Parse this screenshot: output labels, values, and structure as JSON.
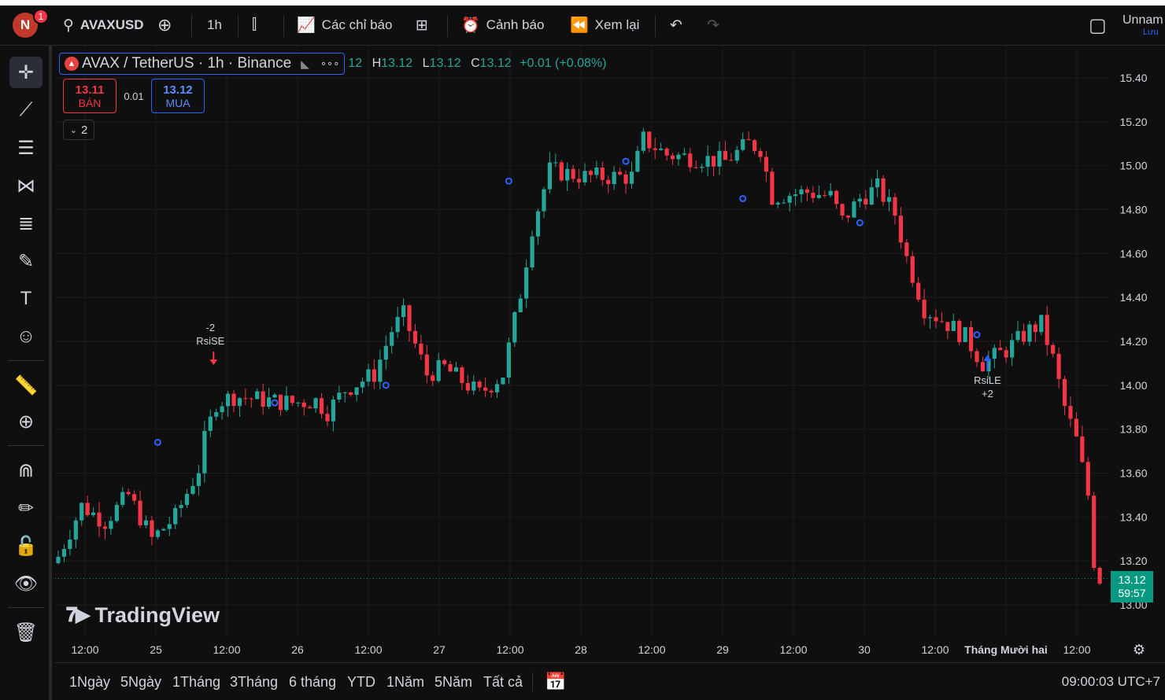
{
  "user": {
    "initial": "N",
    "notifications": "1"
  },
  "toolbar": {
    "symbol": "AVAXUSD",
    "interval": "1h",
    "indicators": "Các chỉ báo",
    "alerts": "Cảnh báo",
    "replay": "Xem lại",
    "layout_name": "Unnam",
    "layout_sub": "Lưu"
  },
  "legend": {
    "title": "AVAX / TetherUS · 1h · Binance",
    "open_fragment": "12",
    "h_label": "H",
    "h": "13.12",
    "l_label": "L",
    "l": "13.12",
    "c_label": "C",
    "c": "13.12",
    "change": "+0.01 (+0.08%)",
    "more": "∘∘∘"
  },
  "trade": {
    "sell_price": "13.11",
    "sell_label": "BÁN",
    "spread": "0.01",
    "buy_price": "13.12",
    "buy_label": "MUA",
    "collapse_count": "2"
  },
  "watermark": "TradingView",
  "price_badge": {
    "price": "13.12",
    "countdown": "59:57"
  },
  "ranges": [
    "1Ngày",
    "5Ngày",
    "1Tháng",
    "3Tháng",
    "6 tháng",
    "YTD",
    "1Năm",
    "5Năm",
    "Tất cả"
  ],
  "clock": "09:00:03 UTC+7",
  "colors": {
    "up": "#26a69a",
    "down": "#f23645",
    "marker": "#2962ff",
    "badge": "#089981"
  },
  "chart_data": {
    "type": "candlestick",
    "ylim": [
      12.88,
      15.52
    ],
    "y_ticks": [
      "15.40",
      "15.20",
      "15.00",
      "14.80",
      "14.60",
      "14.40",
      "14.20",
      "14.00",
      "13.80",
      "13.60",
      "13.40",
      "13.20",
      "13.00"
    ],
    "x_ticks": [
      "12:00",
      "25",
      "12:00",
      "26",
      "12:00",
      "27",
      "12:00",
      "28",
      "12:00",
      "29",
      "12:00",
      "30",
      "12:00",
      "Tháng Mười hai",
      "12:00"
    ],
    "last_price": 13.12,
    "annotations": [
      {
        "label": "RsiSE",
        "value": "-2",
        "direction": "down",
        "price": 14.06
      },
      {
        "label": "RsiLE",
        "value": "+2",
        "direction": "up",
        "price": 14.16
      }
    ],
    "close_path": [
      [
        0,
        13.22
      ],
      [
        4,
        13.45
      ],
      [
        8,
        13.38
      ],
      [
        12,
        13.5
      ],
      [
        16,
        13.3
      ],
      [
        20,
        13.4
      ],
      [
        24,
        13.62
      ],
      [
        25,
        13.75
      ],
      [
        27,
        13.92
      ],
      [
        30,
        13.95
      ],
      [
        36,
        13.93
      ],
      [
        40,
        13.92
      ],
      [
        44,
        13.93
      ],
      [
        46,
        13.88
      ],
      [
        49,
        13.98
      ],
      [
        54,
        14.05
      ],
      [
        57,
        14.25
      ],
      [
        59,
        14.32
      ],
      [
        63,
        14.05
      ],
      [
        66,
        14.08
      ],
      [
        70,
        14.0
      ],
      [
        72,
        13.96
      ],
      [
        76,
        14.05
      ],
      [
        79,
        14.42
      ],
      [
        81,
        14.72
      ],
      [
        84,
        14.98
      ],
      [
        90,
        14.95
      ],
      [
        98,
        14.95
      ],
      [
        100,
        15.12
      ],
      [
        104,
        15.05
      ],
      [
        114,
        15.02
      ],
      [
        118,
        15.1
      ],
      [
        120,
        15.08
      ],
      [
        122,
        14.86
      ],
      [
        128,
        14.88
      ],
      [
        132,
        14.86
      ],
      [
        134,
        14.75
      ],
      [
        137,
        14.85
      ],
      [
        140,
        14.9
      ],
      [
        143,
        14.78
      ],
      [
        145,
        14.58
      ],
      [
        148,
        14.35
      ],
      [
        152,
        14.28
      ],
      [
        155,
        14.22
      ],
      [
        158,
        14.1
      ],
      [
        162,
        14.16
      ],
      [
        166,
        14.25
      ],
      [
        168,
        14.28
      ],
      [
        170,
        14.12
      ],
      [
        172,
        13.9
      ],
      [
        174,
        13.75
      ],
      [
        176,
        13.5
      ],
      [
        177,
        13.2
      ],
      [
        178,
        13.12
      ]
    ],
    "markers": [
      [
        17,
        13.74
      ],
      [
        37,
        13.92
      ],
      [
        56,
        14.0
      ],
      [
        77,
        14.93
      ],
      [
        97,
        15.02
      ],
      [
        117,
        14.85
      ],
      [
        137,
        14.74
      ],
      [
        157,
        14.23
      ]
    ]
  }
}
